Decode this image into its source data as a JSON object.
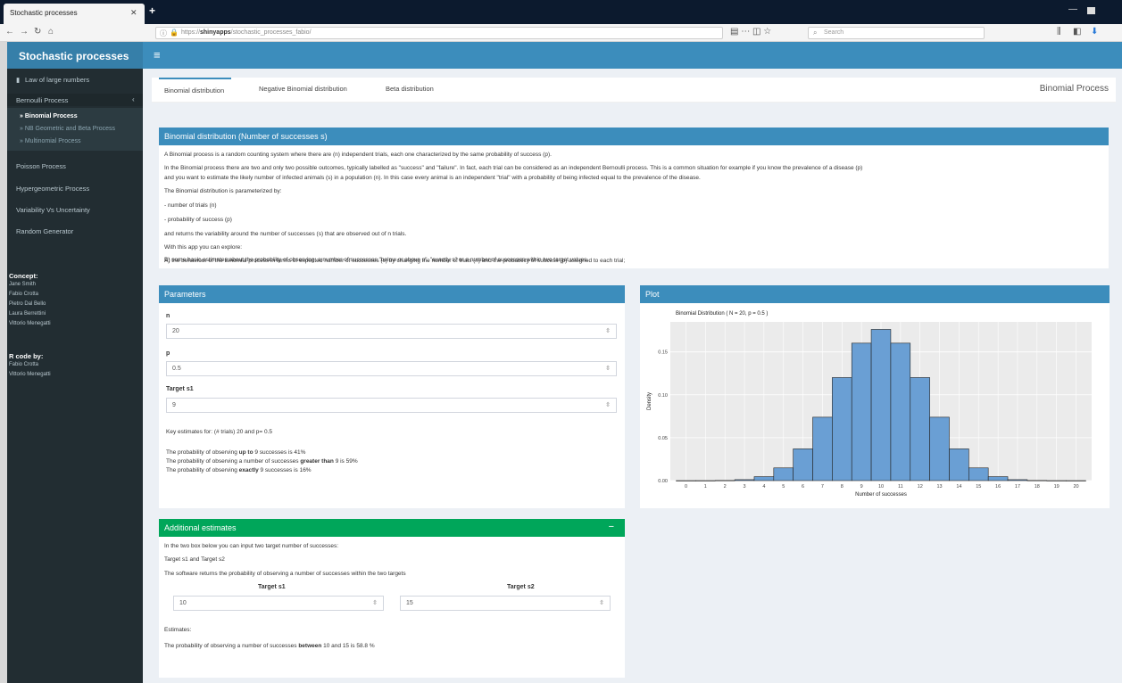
{
  "browser": {
    "tab_title": "Stochastic processes",
    "tab_close": "✕",
    "new_tab": "+",
    "url": "https://",
    "url_host": "shinyapps",
    "url_path": "/stochastic_processes_fabio/",
    "search_placeholder": "Search"
  },
  "app": {
    "title": "Stochastic processes",
    "hamburger": "≡"
  },
  "sidebar": {
    "items": [
      {
        "label": "Law of large numbers"
      },
      {
        "label": "Bernoulli Process"
      },
      {
        "label": "Poisson Process"
      },
      {
        "label": "Hypergeometric Process"
      },
      {
        "label": "Variability Vs Uncertainty"
      },
      {
        "label": "Random Generator"
      }
    ],
    "subitems": [
      {
        "label": "Binomial Process"
      },
      {
        "label": "NB Geometric and Beta Process"
      },
      {
        "label": "Multinomial Process"
      }
    ],
    "concept_heading": "Concept:",
    "concept_names": [
      "Jane Smith",
      "Fabio Crotta",
      "Pietro Dal Bello",
      "Laura Berrettini",
      "Vittorio Menegatti"
    ],
    "code_heading": "R code by:",
    "code_names": [
      "Fabio Crotta",
      "Vittorio Menegatti"
    ]
  },
  "tabs": {
    "items": [
      "Binomial distribution",
      "Negative Binomial distribution",
      "Beta distribution"
    ],
    "title": "Binomial Process"
  },
  "intro": {
    "header": "Binomial distribution (Number of successes s)",
    "lines": [
      "A Binomial process is a random counting system where there are (n) independent trials, each one characterized by the same probability of success (p).",
      "In the Binomial process there are two and only two possible outcomes, typically labelled as \"success\" and \"failure\". In fact, each trial can be considered as an independent Bernoulli process. This is a common situation for example if you know the prevalence of a disease (p)",
      "and you want to estimate the likely number of infected animals (s) in a population (n). In this case every animal is an independent \"trial\" with a probability of being infected equal to the prevalence of the disease.",
      "The Binomial distribution is parameterized by:",
      "- number of trials (n)",
      "- probability of success (p)",
      "and returns the variability around the number of successes (s) that are observed out of n trials.",
      "With this app you can explore:",
      "A) the behaviour of the Binomial process in terms of expected number of successes (s) by changing the number of trials (n) and the probability of success (p) assigned to each trial;",
      "B) some basic estimates about the probability of observing: a number of successes \"below or above s\", \"exactly s\" or a number of successes within two target values."
    ]
  },
  "parameters": {
    "header": "Parameters",
    "n_label": "n",
    "n_value": "20",
    "p_label": "p",
    "p_value": "0.5",
    "target_label": "Target s1",
    "target_value": "9",
    "estimates_title": "Key estimates for: (# trials) 20 and p= 0.5",
    "est1_a": "The probability of observing ",
    "est1_b": "up to",
    "est1_c": " 9 successes is 41%",
    "est2_a": "The probability of observing a number of successes ",
    "est2_b": "greater than",
    "est2_c": " 9 is 59%",
    "est3_a": "The probability of observing ",
    "est3_b": "exactly",
    "est3_c": " 9 successes is 16%"
  },
  "plot_box": {
    "header": "Plot"
  },
  "additional": {
    "header": "Additional estimates",
    "collapse": "−",
    "line1": "In the two box below you can input two target number of successes:",
    "line2": "Target s1 and Target s2",
    "line3": "The software returns the probability of observing a number of successes within the two targets",
    "t1_label": "Target s1",
    "t1_value": "10",
    "t2_label": "Target s2",
    "t2_value": "15",
    "estimates_label": "Estimates:",
    "result_a": "The probability of observing a number of successes ",
    "result_b": "between",
    "result_c": " 10 and 15 is 58.8 %"
  },
  "chart_data": {
    "type": "bar",
    "title": "Binomial Distribution ( N = 20, p = 0.5 )",
    "xlabel": "Number of successes",
    "ylabel": "Density",
    "categories": [
      "0",
      "1",
      "2",
      "3",
      "4",
      "5",
      "6",
      "7",
      "8",
      "9",
      "10",
      "11",
      "12",
      "13",
      "14",
      "15",
      "16",
      "17",
      "18",
      "19",
      "20"
    ],
    "values": [
      1e-06,
      2e-05,
      0.0002,
      0.0011,
      0.0046,
      0.0148,
      0.037,
      0.0739,
      0.1201,
      0.1602,
      0.1762,
      0.1602,
      0.1201,
      0.0739,
      0.037,
      0.0148,
      0.0046,
      0.0011,
      0.0002,
      2e-05,
      1e-06
    ],
    "ylim": [
      0,
      0.185
    ],
    "yticks": [
      "0.00",
      "0.05",
      "0.10",
      "0.15"
    ],
    "bar_color": "#6a9fd4",
    "grid": true
  }
}
